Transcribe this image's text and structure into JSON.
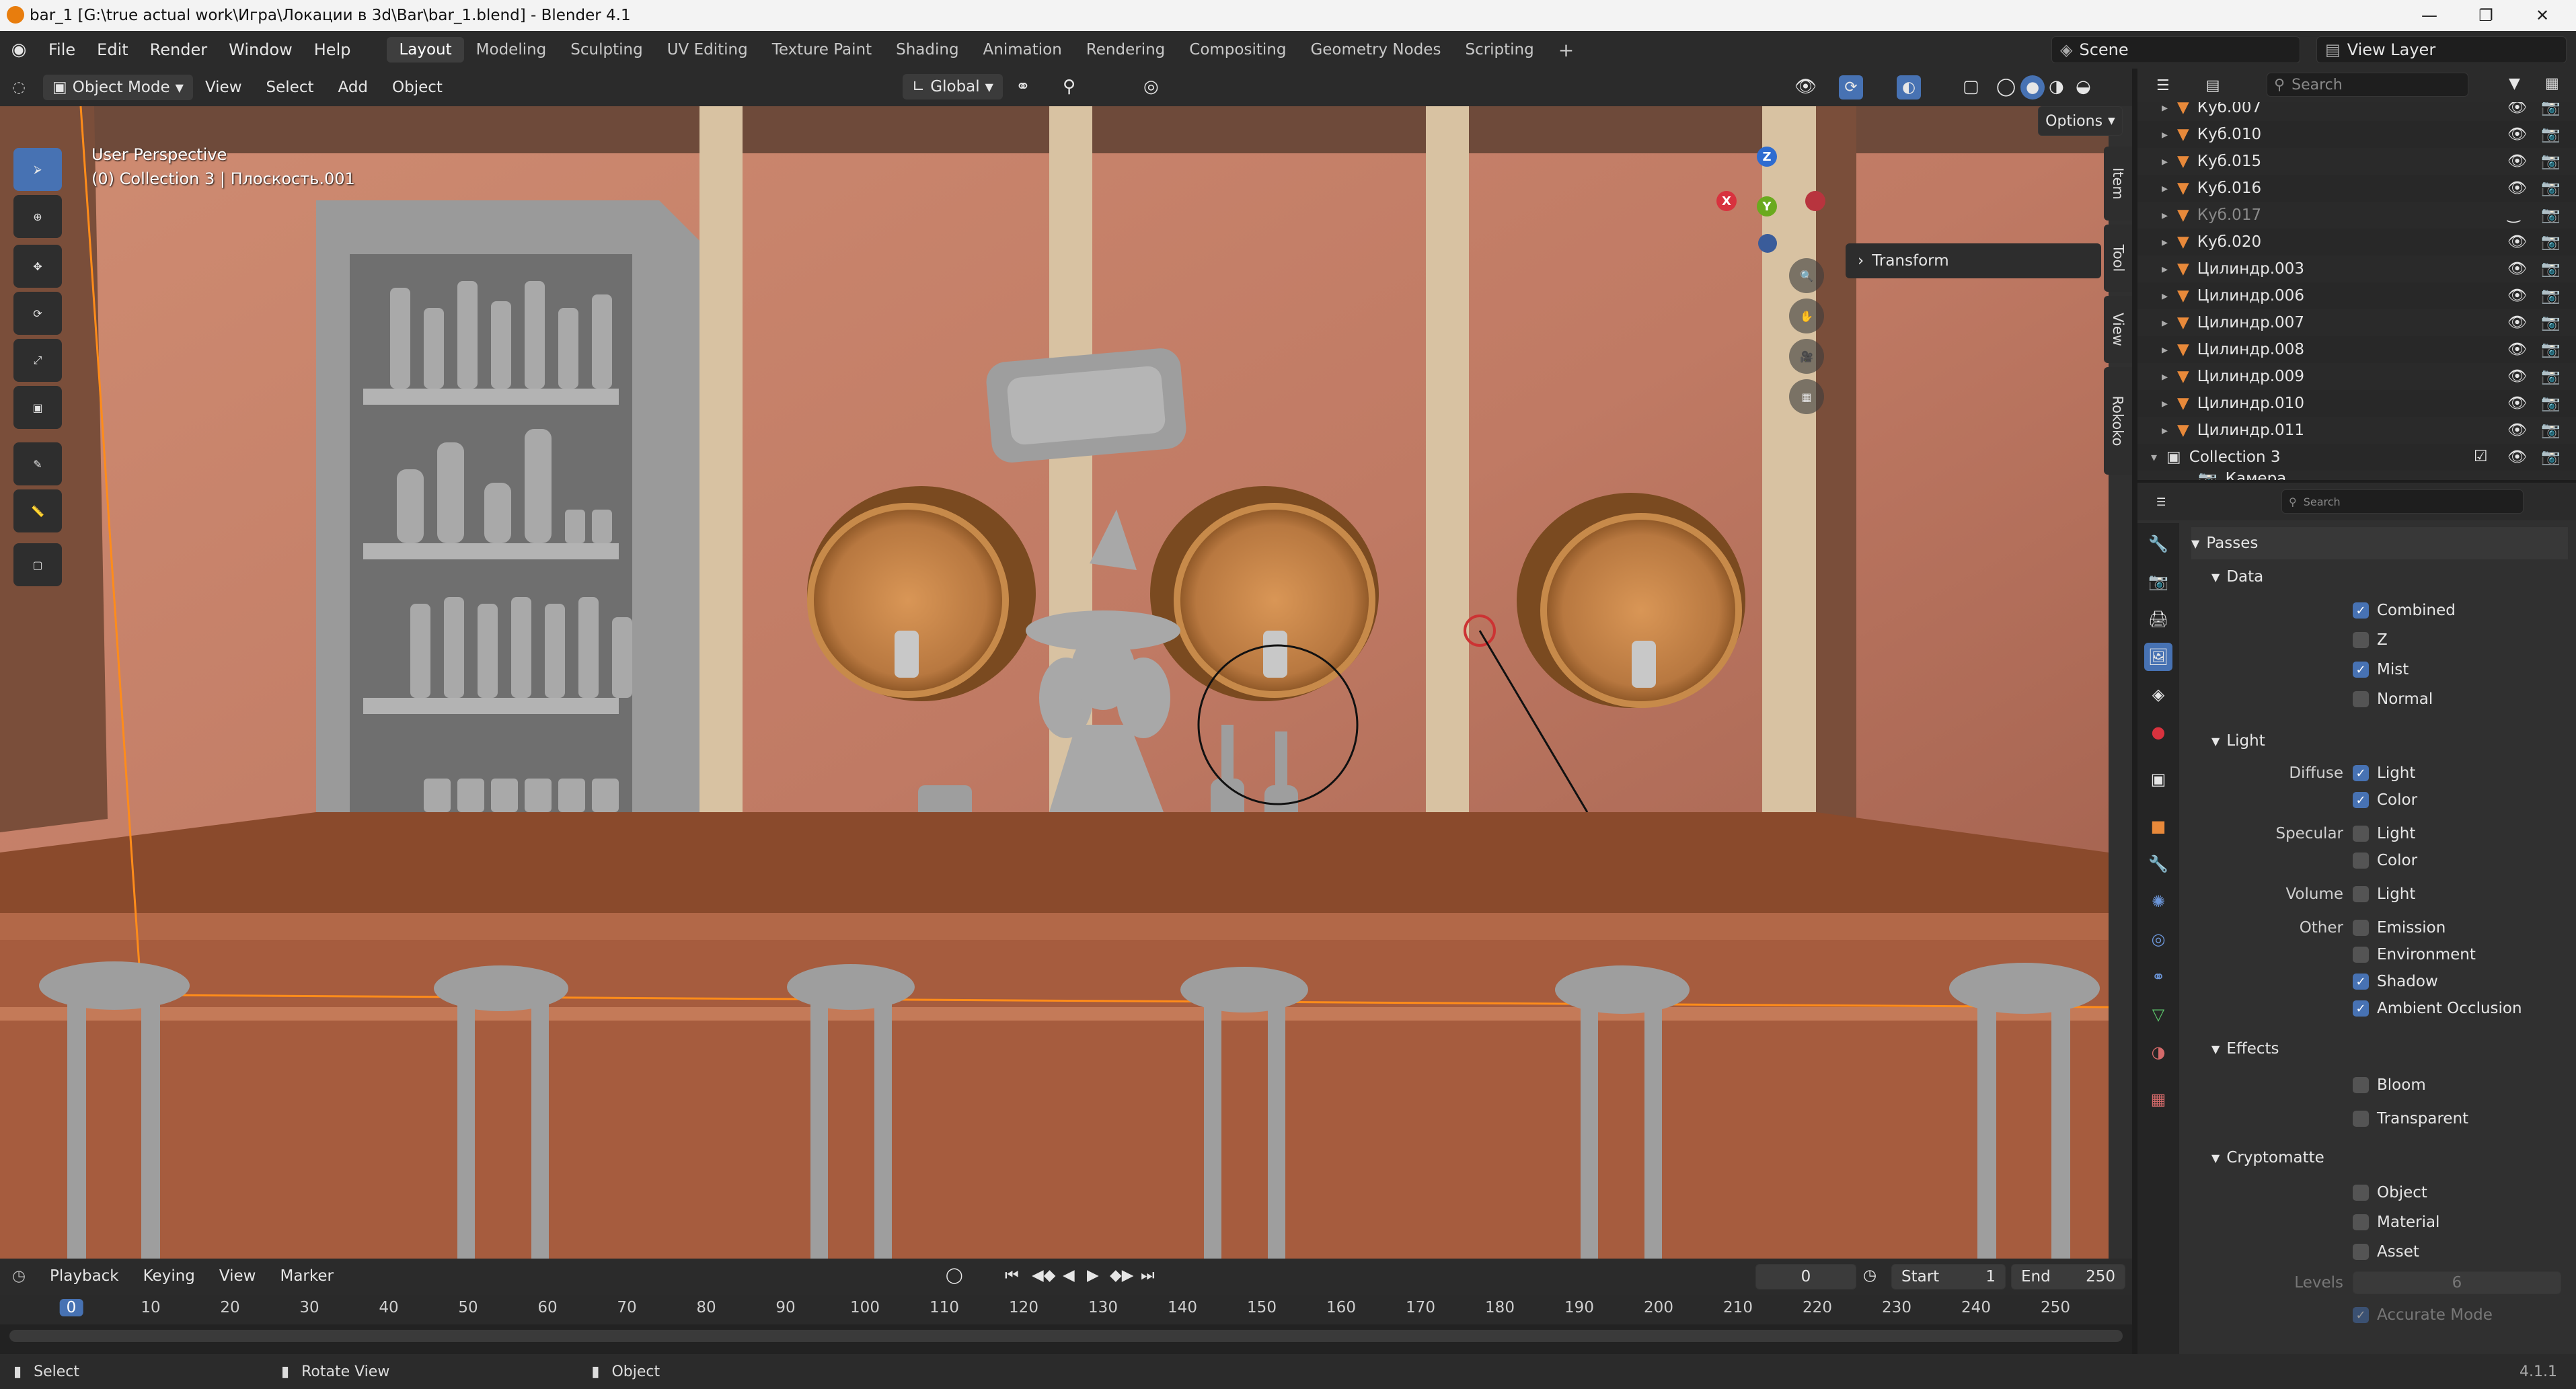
{
  "window": {
    "title": "bar_1 [G:\\true actual work\\Игра\\Локации в 3d\\Bar\\bar_1.blend] - Blender 4.1"
  },
  "menu": [
    "File",
    "Edit",
    "Render",
    "Window",
    "Help"
  ],
  "workspaces": [
    "Layout",
    "Modeling",
    "Sculpting",
    "UV Editing",
    "Texture Paint",
    "Shading",
    "Animation",
    "Rendering",
    "Compositing",
    "Geometry Nodes",
    "Scripting"
  ],
  "scene": {
    "name": "Scene",
    "view_layer": "View Layer"
  },
  "viewport_header": {
    "mode": "Object Mode",
    "menus": [
      "View",
      "Select",
      "Add",
      "Object"
    ],
    "orientation": "Global",
    "options": "Options"
  },
  "viewport": {
    "perspective": "User Perspective",
    "context": "(0) Collection 3 | Плоскость.001",
    "npanel_transform": "Transform",
    "side_tabs": [
      "Item",
      "Tool",
      "View",
      "Rokoko"
    ],
    "gizmo_axes": {
      "x": "X",
      "y": "Y",
      "z": "Z"
    }
  },
  "outliner": {
    "search_placeholder": "Search",
    "items": [
      {
        "name": "Куб.007",
        "dim": false
      },
      {
        "name": "Куб.010",
        "dim": false
      },
      {
        "name": "Куб.015",
        "dim": false
      },
      {
        "name": "Куб.016",
        "dim": false
      },
      {
        "name": "Куб.017",
        "dim": true
      },
      {
        "name": "Куб.020",
        "dim": false
      },
      {
        "name": "Цилиндр.003",
        "dim": false
      },
      {
        "name": "Цилиндр.006",
        "dim": false
      },
      {
        "name": "Цилиндр.007",
        "dim": false
      },
      {
        "name": "Цилиндр.008",
        "dim": false
      },
      {
        "name": "Цилиндр.009",
        "dim": false
      },
      {
        "name": "Цилиндр.010",
        "dim": false
      },
      {
        "name": "Цилиндр.011",
        "dim": false
      }
    ],
    "collection": "Collection 3",
    "partial_child": "Камера"
  },
  "properties": {
    "search_placeholder": "Search",
    "passes_title": "Passes",
    "data": {
      "title": "Data",
      "items": [
        {
          "label": "Combined",
          "checked": true
        },
        {
          "label": "Z",
          "checked": false
        },
        {
          "label": "Mist",
          "checked": true
        },
        {
          "label": "Normal",
          "checked": false
        }
      ]
    },
    "light": {
      "title": "Light",
      "diffuse": "Diffuse",
      "specular": "Specular",
      "volume": "Volume",
      "other": "Other",
      "diffuse_light": "Light",
      "diffuse_color": "Color",
      "specular_light": "Light",
      "specular_color": "Color",
      "volume_light": "Light",
      "emission": "Emission",
      "environment": "Environment",
      "shadow": "Shadow",
      "ao": "Ambient Occlusion"
    },
    "effects": {
      "title": "Effects",
      "bloom": "Bloom",
      "transparent": "Transparent"
    },
    "crypto": {
      "title": "Cryptomatte",
      "object": "Object",
      "material": "Material",
      "asset": "Asset",
      "levels_label": "Levels",
      "levels": "6",
      "accurate": "Accurate Mode"
    }
  },
  "timeline": {
    "menus": [
      "Playback",
      "Keying",
      "View",
      "Marker"
    ],
    "current_frame": "0",
    "start_label": "Start",
    "start": "1",
    "end_label": "End",
    "end": "250",
    "ticks": [
      "0",
      "10",
      "20",
      "30",
      "40",
      "50",
      "60",
      "70",
      "80",
      "90",
      "100",
      "110",
      "120",
      "130",
      "140",
      "150",
      "160",
      "170",
      "180",
      "190",
      "200",
      "210",
      "220",
      "230",
      "240",
      "250"
    ]
  },
  "status": {
    "select": "Select",
    "rotate": "Rotate View",
    "object": "Object",
    "version": "4.1.1"
  },
  "colors": {
    "accent": "#4772b3",
    "wall": "#c9846a",
    "wood": "#8a4a2c",
    "copper": "#c07a40",
    "selection": "#ff8c1a"
  }
}
